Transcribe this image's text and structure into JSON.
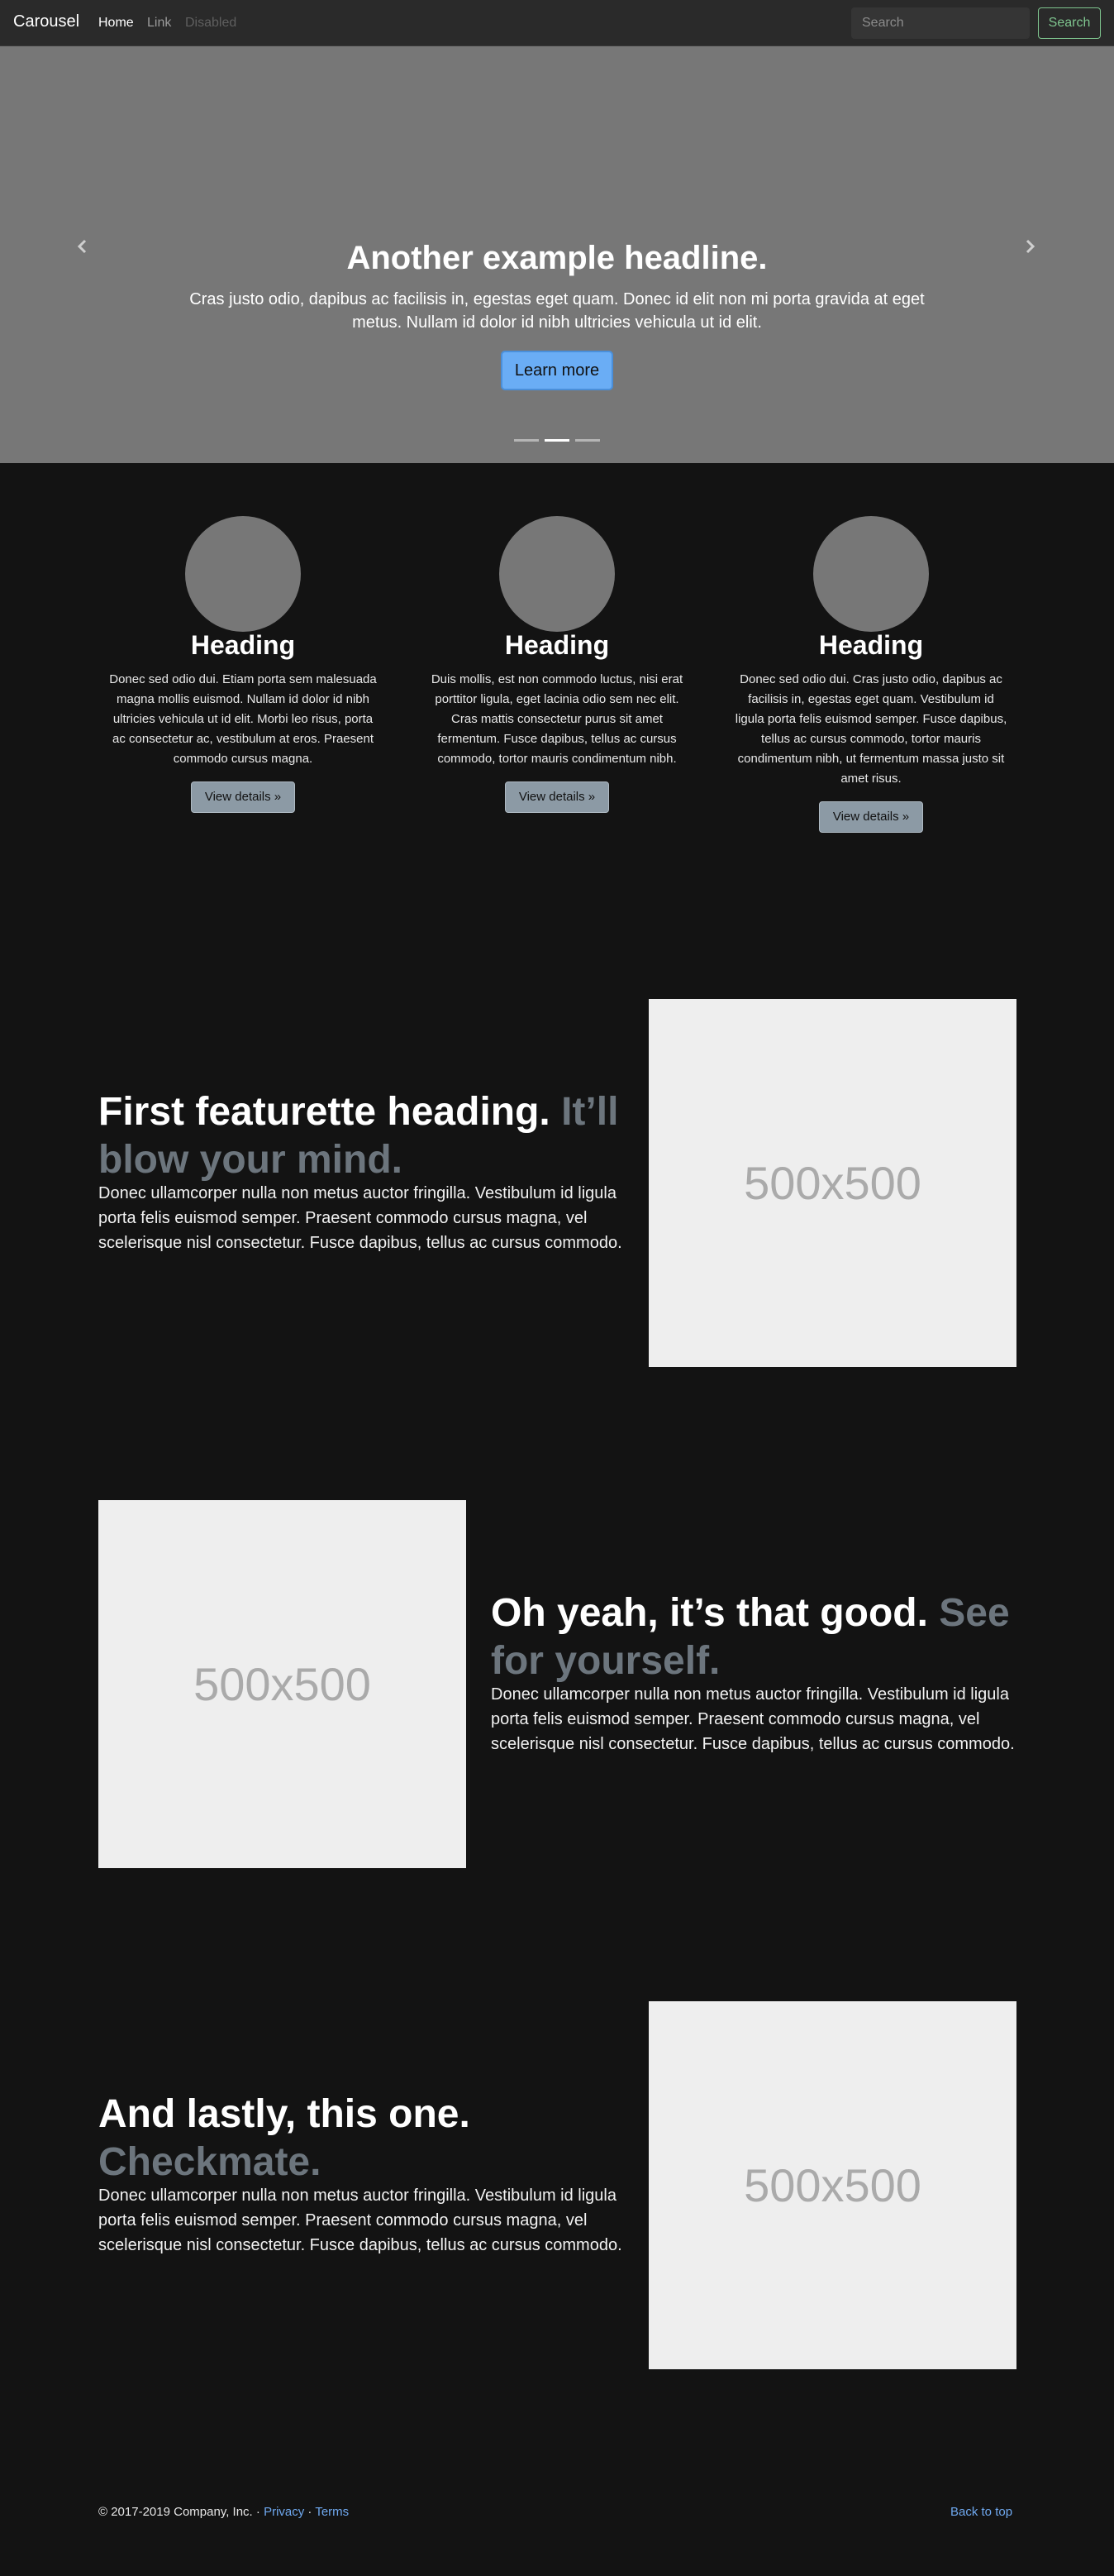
{
  "navbar": {
    "brand": "Carousel",
    "links": [
      "Home",
      "Link",
      "Disabled"
    ],
    "search_placeholder": "Search",
    "search_button": "Search"
  },
  "carousel": {
    "heading": "Another example headline.",
    "text": "Cras justo odio, dapibus ac facilisis in, egestas eget quam. Donec id elit non mi porta gravida at eget metus. Nullam id dolor id nibh ultricies vehicula ut id elit.",
    "button": "Learn more",
    "slide_count": 3,
    "active_slide": 2,
    "icons": {
      "prev": "chevron-left-icon",
      "next": "chevron-right-icon"
    }
  },
  "marketing": [
    {
      "heading": "Heading",
      "text": "Donec sed odio dui. Etiam porta sem malesuada magna mollis euismod. Nullam id dolor id nibh ultricies vehicula ut id elit. Morbi leo risus, porta ac consectetur ac, vestibulum at eros. Praesent commodo cursus magna.",
      "button": "View details »"
    },
    {
      "heading": "Heading",
      "text": "Duis mollis, est non commodo luctus, nisi erat porttitor ligula, eget lacinia odio sem nec elit. Cras mattis consectetur purus sit amet fermentum. Fusce dapibus, tellus ac cursus commodo, tortor mauris condimentum nibh.",
      "button": "View details »"
    },
    {
      "heading": "Heading",
      "text": "Donec sed odio dui. Cras justo odio, dapibus ac facilisis in, egestas eget quam. Vestibulum id ligula porta felis euismod semper. Fusce dapibus, tellus ac cursus commodo, tortor mauris condimentum nibh, ut fermentum massa justo sit amet risus.",
      "button": "View details »"
    }
  ],
  "featurettes": [
    {
      "heading": "First featurette heading.",
      "muted": "It’ll blow your mind.",
      "text": "Donec ullamcorper nulla non metus auctor fringilla. Vestibulum id ligula porta felis euismod semper. Praesent commodo cursus magna, vel scelerisque nisl consectetur. Fusce dapibus, tellus ac cursus commodo.",
      "image_label": "500x500"
    },
    {
      "heading": "Oh yeah, it’s that good.",
      "muted": "See for yourself.",
      "text": "Donec ullamcorper nulla non metus auctor fringilla. Vestibulum id ligula porta felis euismod semper. Praesent commodo cursus magna, vel scelerisque nisl consectetur. Fusce dapibus, tellus ac cursus commodo.",
      "image_label": "500x500"
    },
    {
      "heading": "And lastly, this one.",
      "muted": "Checkmate.",
      "text": "Donec ullamcorper nulla non metus auctor fringilla. Vestibulum id ligula porta felis euismod semper. Praesent commodo cursus magna, vel scelerisque nisl consectetur. Fusce dapibus, tellus ac cursus commodo.",
      "image_label": "500x500"
    }
  ],
  "footer": {
    "copyright": "© 2017-2019 Company, Inc. ·",
    "privacy": "Privacy",
    "separator": "·",
    "terms": "Terms",
    "back_to_top": "Back to top"
  },
  "colors": {
    "background": "#131313",
    "navbar": "#2a2a2a",
    "carousel": "#777777",
    "primary_button": "#6aadf5",
    "success_outline": "#7fc58f",
    "secondary_button": "#8c9aa5",
    "link": "#6fa8ef",
    "muted": "#6c757d",
    "placeholder": "#eeeeee"
  }
}
